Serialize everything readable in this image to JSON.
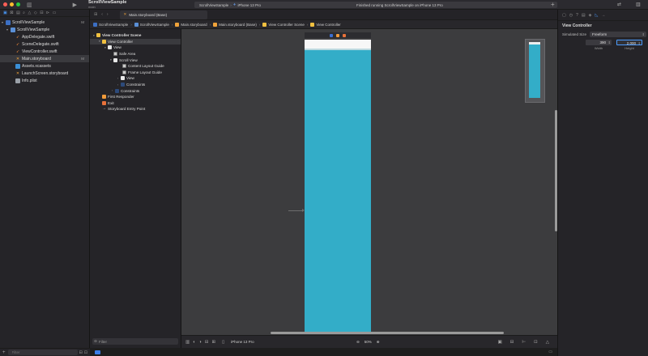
{
  "toolbar": {
    "project_name": "ScrollViewSample",
    "branch": "main",
    "scheme_target": "ScrollViewSample",
    "scheme_device": "iPhone 13 Pro",
    "status": "Finished running ScrollViewSample on iPhone 13 Pro"
  },
  "navigator": {
    "items": [
      {
        "label": "ScrollViewSample",
        "badge": "M"
      },
      {
        "label": "ScrollViewSample",
        "badge": ""
      },
      {
        "label": "AppDelegate.swift",
        "badge": ""
      },
      {
        "label": "SceneDelegate.swift",
        "badge": ""
      },
      {
        "label": "ViewController.swift",
        "badge": ""
      },
      {
        "label": "Main.storyboard",
        "badge": "M"
      },
      {
        "label": "Assets.xcassets",
        "badge": ""
      },
      {
        "label": "LaunchScreen.storyboard",
        "badge": ""
      },
      {
        "label": "Info.plist",
        "badge": ""
      }
    ],
    "filter_placeholder": "Filter"
  },
  "editor": {
    "tab_label": "Main.storyboard (Base)",
    "breadcrumbs": [
      "ScrollViewSample",
      "ScrollViewSample",
      "Main.storyboard",
      "Main.storyboard (Base)",
      "View Controller Scene",
      "View Controller"
    ]
  },
  "outline": {
    "items": [
      {
        "label": "View Controller Scene"
      },
      {
        "label": "View Controller"
      },
      {
        "label": "View"
      },
      {
        "label": "Safe Area"
      },
      {
        "label": "Scroll View"
      },
      {
        "label": "Content Layout Guide"
      },
      {
        "label": "Frame Layout Guide"
      },
      {
        "label": "View"
      },
      {
        "label": "Constraints"
      },
      {
        "label": "Constraints"
      },
      {
        "label": "First Responder"
      },
      {
        "label": "Exit"
      },
      {
        "label": "Storyboard Entry Point"
      }
    ],
    "filter_placeholder": "Filter"
  },
  "canvas": {
    "device": "iPhone 13 Pro",
    "zoom": "50%"
  },
  "inspector": {
    "section_title": "View Controller",
    "simulated_size_label": "Simulated Size",
    "simulated_size_value": "Freeform",
    "width_value": "390",
    "height_value": "2,000",
    "width_label": "Width",
    "height_label": "Height"
  }
}
